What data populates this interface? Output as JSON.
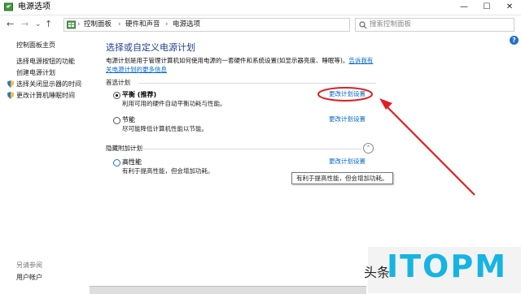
{
  "window": {
    "title": "电源选项",
    "controls": [
      "—",
      "☐",
      "✕"
    ]
  },
  "nav": {
    "back": "←",
    "forward": "→",
    "recent": "⌄",
    "up": "↑",
    "breadcrumbs": [
      "控制面板",
      "硬件和声音",
      "电源选项"
    ],
    "separator": "›",
    "dropdown": "⌄",
    "refresh": "⟳",
    "search_placeholder": "搜索控制面板"
  },
  "help_icon": "?",
  "sidebar": {
    "home": "控制面板主页",
    "items": [
      {
        "label": "选择电源按钮的功能"
      },
      {
        "label": "创建电源计划"
      },
      {
        "label": "选择关闭显示器的时间",
        "icon": "shield-icon"
      },
      {
        "label": "更改计算机睡眠时间",
        "icon": "shield-icon"
      }
    ],
    "see_also": "另请参阅",
    "user_accounts": "用户帐户"
  },
  "main": {
    "title": "选择或自定义电源计划",
    "description": "电源计划是用于管理计算机如何使用电源的一套硬件和系统设置(如显示器亮度、睡眠等)。",
    "learn_more_link": "告诉我有关电源计划的更多信息",
    "preferred_section": "首选计划",
    "hidden_section": "隐藏附加计划",
    "collapse_icon": "⌃",
    "plans": [
      {
        "name": "平衡 (推荐)",
        "desc": "利用可用的硬件自动平衡功耗与性能。",
        "link": "更改计划设置",
        "selected": true
      },
      {
        "name": "节能",
        "desc": "尽可能降低计算机性能以节能。",
        "link": "更改计划设置",
        "selected": false
      },
      {
        "name": "高性能",
        "desc": "有利于提高性能，但会增加功耗。",
        "link": "更改计划设置",
        "selected": false
      }
    ],
    "tooltip": "有利于提高性能，但会增加功耗。"
  },
  "annotation": {
    "color": "#e02020"
  },
  "watermark": {
    "small": "头条",
    "logo": "ITOPM"
  },
  "colors": {
    "link": "#0066cc",
    "title": "#1f3f8f",
    "brand": "#16b4e3"
  }
}
